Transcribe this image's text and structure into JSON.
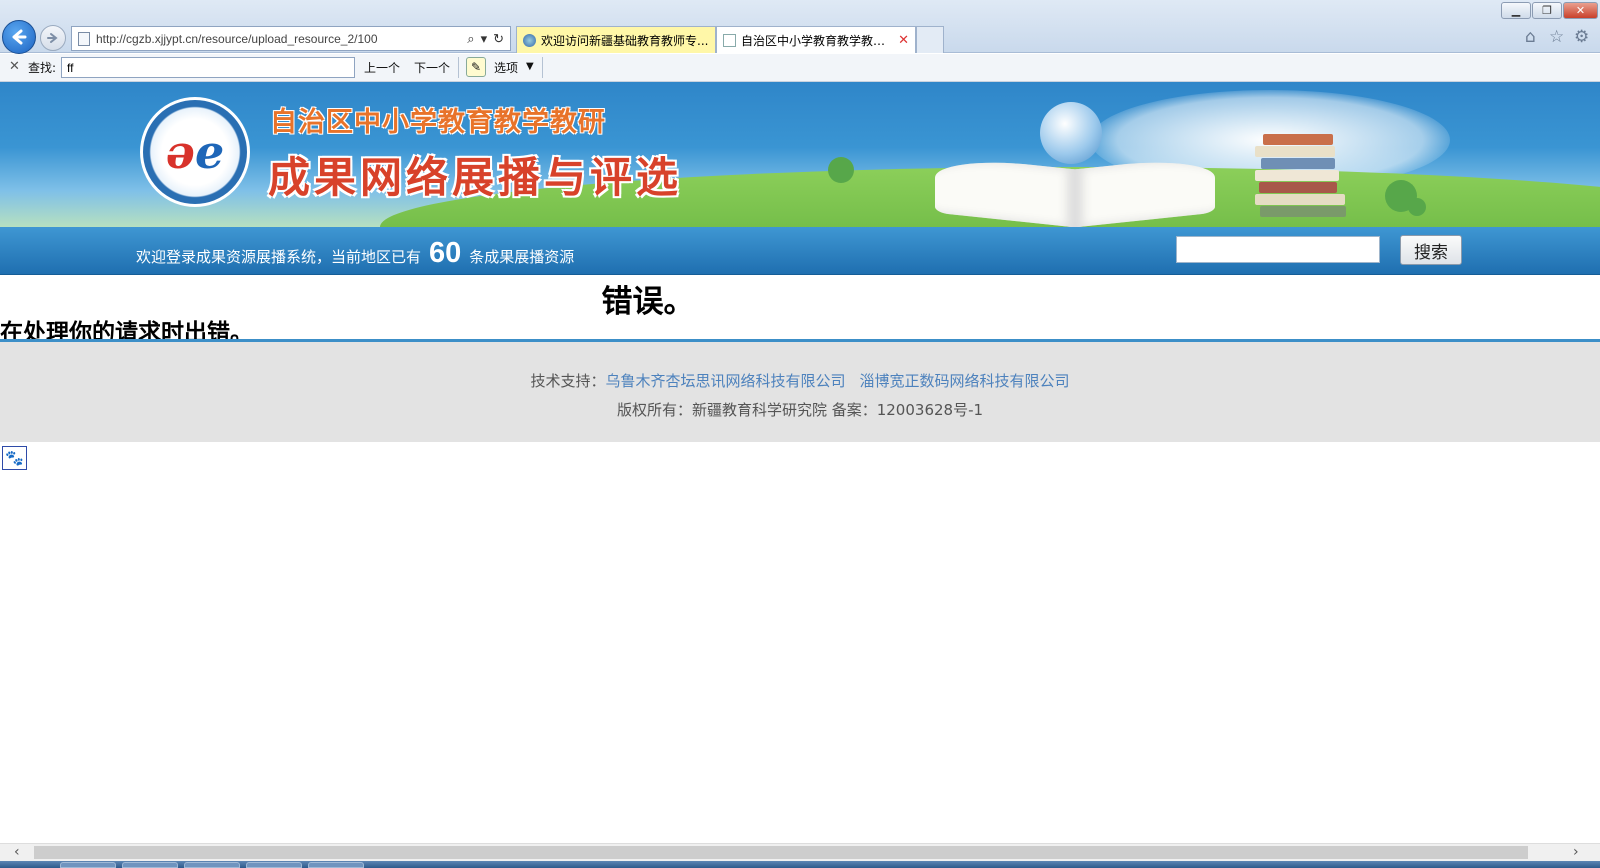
{
  "browser": {
    "url": "http://cgzb.xjjypt.cn/resource/upload_resource_2/100",
    "tabs": [
      {
        "title": "欢迎访问新疆基础教育教师专...",
        "active": false,
        "color": "#fff7a8"
      },
      {
        "title": "自治区中小学教育教学教研...",
        "active": true,
        "color": "#ffffff"
      }
    ],
    "icons": {
      "back": "back-arrow-icon",
      "forward": "forward-arrow-icon",
      "home": "home-icon",
      "favorites": "star-icon",
      "tools": "gear-icon"
    }
  },
  "findbar": {
    "label": "查找:",
    "query": "ff",
    "prev": "上一个",
    "next": "下一个",
    "options": "选项"
  },
  "banner": {
    "title_line_1": "自治区中小学教育教学教研",
    "title_line_2": "成果网络展播与评选",
    "colors": {
      "sky": "#2f86c9",
      "title_orange": "#e8732a",
      "title_red": "#d8422a"
    }
  },
  "welcome": {
    "prefix": "欢迎登录成果资源展播系统，当前地区已有",
    "count": "60",
    "suffix": "条成果展播资源"
  },
  "search": {
    "value": "",
    "button_label": "搜索"
  },
  "error": {
    "heading": "错误。",
    "message": "在处理你的请求时出错。"
  },
  "footer": {
    "support_label": "技术支持：",
    "support_links": [
      "乌鲁木齐杏坛思讯网络科技有限公司",
      "淄博宽正数码网络科技有限公司"
    ],
    "copyright": "版权所有：新疆教育科学研究院 备案：12003628号-1",
    "colors": {
      "link": "#4d82bd",
      "accent_border": "#3c8fc8"
    }
  }
}
